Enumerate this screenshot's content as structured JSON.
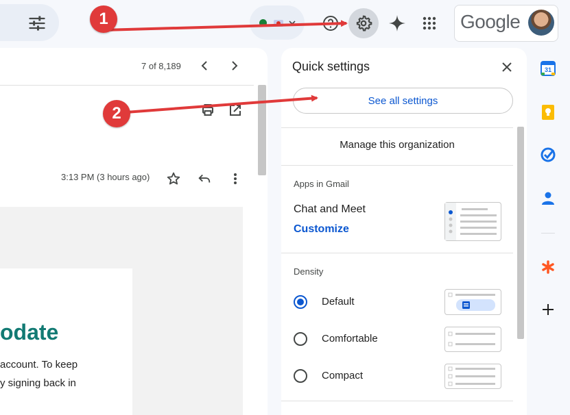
{
  "header": {
    "google_logo": "Google",
    "icons": [
      "tune-icon",
      "help-icon",
      "gear-icon",
      "gemini-icon",
      "apps-grid-icon"
    ]
  },
  "mail": {
    "pager": "7 of 8,189",
    "timestamp": "3:13 PM (3 hours ago)",
    "headline": "odate",
    "body_line1": "account. To keep",
    "body_line2": "y signing back in"
  },
  "quick_settings": {
    "title": "Quick settings",
    "see_all": "See all settings",
    "manage_org": "Manage this organization",
    "apps_section": "Apps in Gmail",
    "chat_meet": "Chat and Meet",
    "customize": "Customize",
    "density_section": "Density",
    "density_options": [
      {
        "label": "Default",
        "selected": true
      },
      {
        "label": "Comfortable",
        "selected": false
      },
      {
        "label": "Compact",
        "selected": false
      }
    ]
  },
  "annotations": {
    "step1": "1",
    "step2": "2",
    "color": "#e03a3a"
  },
  "colors": {
    "accent": "#0b57d0",
    "headline": "#127a73",
    "status": "#188038"
  }
}
